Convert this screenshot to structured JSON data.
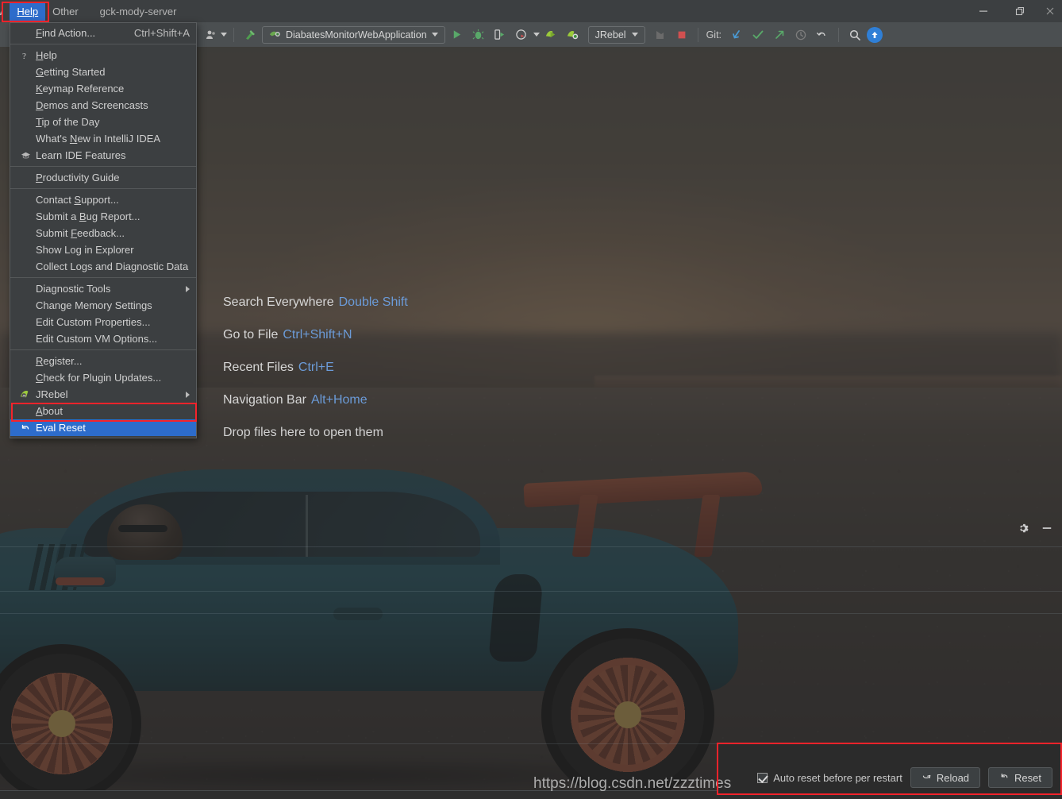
{
  "window": {
    "title": "gck-mody-server",
    "controls": [
      {
        "name": "minimize",
        "glyph": "—"
      },
      {
        "name": "restore",
        "glyph": "❐"
      },
      {
        "name": "close",
        "glyph": "✕"
      }
    ]
  },
  "menubar": {
    "items": [
      {
        "label": "w",
        "partial": true,
        "active": false
      },
      {
        "label": "Help",
        "mnemonic": "H",
        "active": true
      },
      {
        "label": "Other",
        "mnemonic": "O",
        "active": false
      }
    ]
  },
  "toolbar": {
    "run_config": "DiabatesMonitorWebApplication",
    "jrebel_label": "JRebel",
    "git_label": "Git:",
    "icons": [
      "user-avatar-icon",
      "hammer-build-icon",
      "run-icon",
      "debug-icon",
      "run-with-coverage-icon",
      "profile-icon",
      "jrebel-run-icon",
      "jrebel-debug-icon",
      "attach-icon",
      "stop-icon",
      "git-update-icon",
      "git-commit-icon",
      "git-push-icon",
      "git-history-icon",
      "git-rollback-icon",
      "search-icon",
      "updates-icon"
    ]
  },
  "help_menu": {
    "groups": [
      [
        {
          "label": "Find Action...",
          "mnemonic": "F",
          "shortcut": "Ctrl+Shift+A",
          "icon": null
        }
      ],
      [
        {
          "label": "Help",
          "mnemonic": "H",
          "icon": "question-mark-icon"
        },
        {
          "label": "Getting Started",
          "mnemonic": "G",
          "icon": null
        },
        {
          "label": "Keymap Reference",
          "mnemonic": "K",
          "icon": null
        },
        {
          "label": "Demos and Screencasts",
          "mnemonic": "D",
          "icon": null
        },
        {
          "label": "Tip of the Day",
          "mnemonic": "T",
          "icon": null
        },
        {
          "label": "What's New in IntelliJ IDEA",
          "mnemonic": "N",
          "icon": null
        },
        {
          "label": "Learn IDE Features",
          "icon": "graduation-cap-icon"
        }
      ],
      [
        {
          "label": "Productivity Guide",
          "mnemonic": "P",
          "icon": null
        }
      ],
      [
        {
          "label": "Contact Support...",
          "mnemonic": "S",
          "icon": null
        },
        {
          "label": "Submit a Bug Report...",
          "mnemonic": "B",
          "icon": null
        },
        {
          "label": "Submit Feedback...",
          "mnemonic": "F",
          "icon": null
        },
        {
          "label": "Show Log in Explorer",
          "icon": null
        },
        {
          "label": "Collect Logs and Diagnostic Data",
          "icon": null
        }
      ],
      [
        {
          "label": "Diagnostic Tools",
          "icon": null,
          "submenu": true
        },
        {
          "label": "Change Memory Settings",
          "icon": null
        },
        {
          "label": "Edit Custom Properties...",
          "icon": null
        },
        {
          "label": "Edit Custom VM Options...",
          "icon": null
        }
      ],
      [
        {
          "label": "Register...",
          "mnemonic": "R",
          "icon": null
        },
        {
          "label": "Check for Plugin Updates...",
          "mnemonic": "C",
          "icon": null
        },
        {
          "label": "JRebel",
          "icon": "jrebel-icon",
          "submenu": true
        },
        {
          "label": "About",
          "mnemonic": "A",
          "icon": null
        },
        {
          "label": "Eval Reset",
          "icon": "reset-arrow-icon",
          "selected": true
        }
      ]
    ]
  },
  "welcome": {
    "hints": [
      {
        "action": "Search Everywhere",
        "key": "Double Shift"
      },
      {
        "action": "Go to File",
        "key": "Ctrl+Shift+N"
      },
      {
        "action": "Recent Files",
        "key": "Ctrl+E"
      },
      {
        "action": "Navigation Bar",
        "key": "Alt+Home"
      },
      {
        "action": "Drop files here to open them",
        "key": ""
      }
    ]
  },
  "float_icons": [
    {
      "name": "gear-icon",
      "glyph": "gear"
    },
    {
      "name": "minimize-icon",
      "glyph": "dash"
    }
  ],
  "eval_reset_panel": {
    "checkbox_label": "Auto reset before per restart",
    "checkbox_checked": true,
    "reload_button": "Reload",
    "reset_button": "Reset"
  },
  "watermark": "https://blog.csdn.net/zzztimes",
  "colors": {
    "menu_bg": "#3c3f41",
    "toolbar_bg": "#4b4f51",
    "selection_blue": "#2d6ccb",
    "annotation_red": "#f5232b",
    "hint_key_blue": "#6b9bd8",
    "panel_bg": "#2b2b2b"
  }
}
